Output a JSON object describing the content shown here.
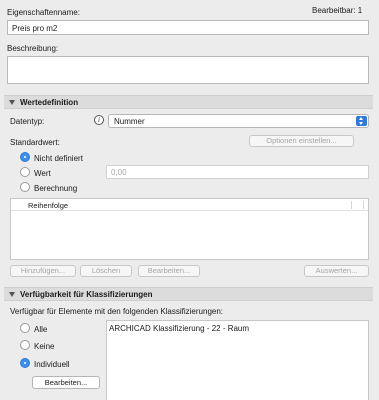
{
  "property": {
    "name_label": "Eigenschaftenname:",
    "editable_label": "Bearbeitbar: 1",
    "name_value": "Preis pro m2",
    "description_label": "Beschreibung:",
    "description_value": ""
  },
  "value_definition": {
    "section_title": "Wertedefinition",
    "datatype_label": "Datentyp:",
    "datatype_value": "Nummer",
    "options_button": "Optionen einstellen...",
    "default_label": "Standardwert:",
    "radios": [
      {
        "label": "Nicht definiert",
        "selected": true
      },
      {
        "label": "Wert",
        "selected": false
      },
      {
        "label": "Berechnung",
        "selected": false
      }
    ],
    "value_placeholder": "0,00",
    "order_column": "Reihenfolge",
    "buttons": {
      "add": "Hinzufügen...",
      "delete": "Löschen",
      "edit": "Bearbeiten...",
      "evaluate": "Auswerten..."
    }
  },
  "availability": {
    "section_title": "Verfügbarkeit für Klassifizierungen",
    "description": "Verfügbar für Elemente mit den folgenden Klassifizierungen:",
    "radios": [
      {
        "label": "Alle",
        "selected": false
      },
      {
        "label": "Keine",
        "selected": false
      },
      {
        "label": "Individuell",
        "selected": true
      }
    ],
    "edit_button": "Bearbeiten...",
    "classifications": [
      "ARCHICAD Klassifizierung - 22 - Raum"
    ]
  }
}
